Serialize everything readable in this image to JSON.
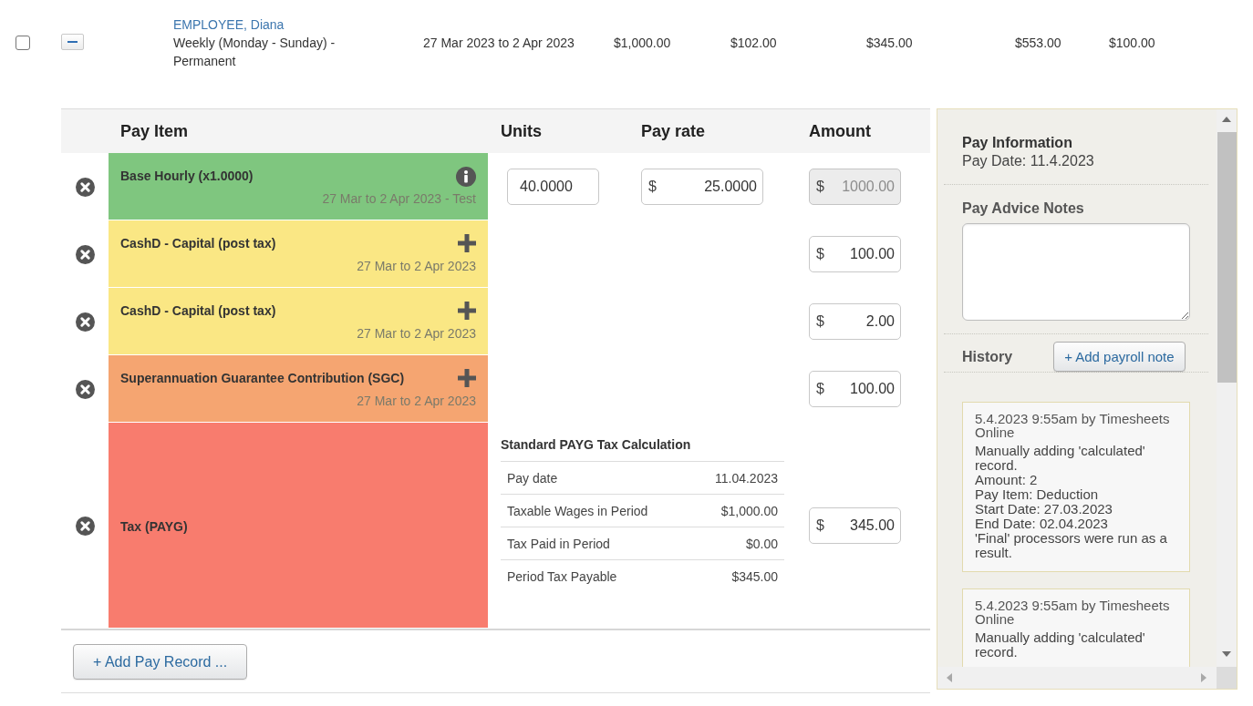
{
  "employee_row": {
    "checked": false,
    "expanded": true,
    "employee": "EMPLOYEE, Diana",
    "pay_schedule": "Weekly (Monday - Sunday) - Permanent",
    "period": "27 Mar 2023 to 2 Apr 2023",
    "cells": [
      "$1,000.00",
      "$102.00",
      "$345.00",
      "$553.00",
      "$100.00"
    ]
  },
  "pay_table": {
    "columns": [
      "Pay Item",
      "Units",
      "Pay rate",
      "Amount"
    ],
    "rows": [
      {
        "kind": "earning",
        "name": "Base Hourly (x1.0000)",
        "period": "27 Mar to 2 Apr 2023 - Test",
        "color": "#7fc67f",
        "units": {
          "value": "40.0000"
        },
        "rate": {
          "prefix": "$",
          "value": "25.0000"
        },
        "amount": {
          "prefix": "$",
          "value": "1000.00",
          "disabled": true
        }
      },
      {
        "kind": "deduction",
        "name": "CashD - Capital (post tax)",
        "period": "27 Mar to 2 Apr 2023",
        "color": "#fae784",
        "amount": {
          "prefix": "$",
          "value": "100.00",
          "disabled": false
        }
      },
      {
        "kind": "deduction",
        "name": "CashD - Capital (post tax)",
        "period": "27 Mar to 2 Apr 2023",
        "color": "#fae784",
        "amount": {
          "prefix": "$",
          "value": "2.00",
          "disabled": false
        }
      },
      {
        "kind": "super",
        "name": "Superannuation Guarantee Contribution (SGC)",
        "period": "27 Mar to 2 Apr 2023",
        "color": "#f5a571",
        "amount": {
          "prefix": "$",
          "value": "100.00",
          "disabled": false
        }
      },
      {
        "kind": "tax",
        "name": "Tax (PAYG)",
        "color": "#f87c6e",
        "tax_calculation": {
          "title": "Standard PAYG Tax Calculation",
          "rows": [
            {
              "label": "Pay date",
              "value": "11.04.2023"
            },
            {
              "label": "Taxable Wages in Period",
              "value": "$1,000.00"
            },
            {
              "label": "Tax Paid in Period",
              "value": "$0.00"
            },
            {
              "label": "Period Tax Payable",
              "value": "$345.00"
            }
          ]
        },
        "amount": {
          "prefix": "$",
          "value": "345.00",
          "disabled": false
        }
      }
    ],
    "add_button": "+ Add Pay Record ..."
  },
  "side_panel": {
    "pay_information": {
      "title": "Pay Information",
      "pay_date": "Pay Date: 11.4.2023"
    },
    "pay_advice_notes": {
      "label": "Pay Advice Notes"
    },
    "history": {
      "title": "History",
      "add_button": "+ Add payroll note",
      "entries": [
        {
          "header": "5.4.2023 9:55am by Timesheets Online",
          "lines": [
            "Manually adding 'calculated' record.",
            "Amount: 2",
            "Pay Item: Deduction",
            "Start Date: 27.03.2023",
            "End Date: 02.04.2023",
            "'Final' processors were run as a result."
          ]
        },
        {
          "header": "5.4.2023 9:55am by Timesheets Online",
          "lines": [
            "Manually adding 'calculated' record."
          ]
        }
      ]
    }
  }
}
